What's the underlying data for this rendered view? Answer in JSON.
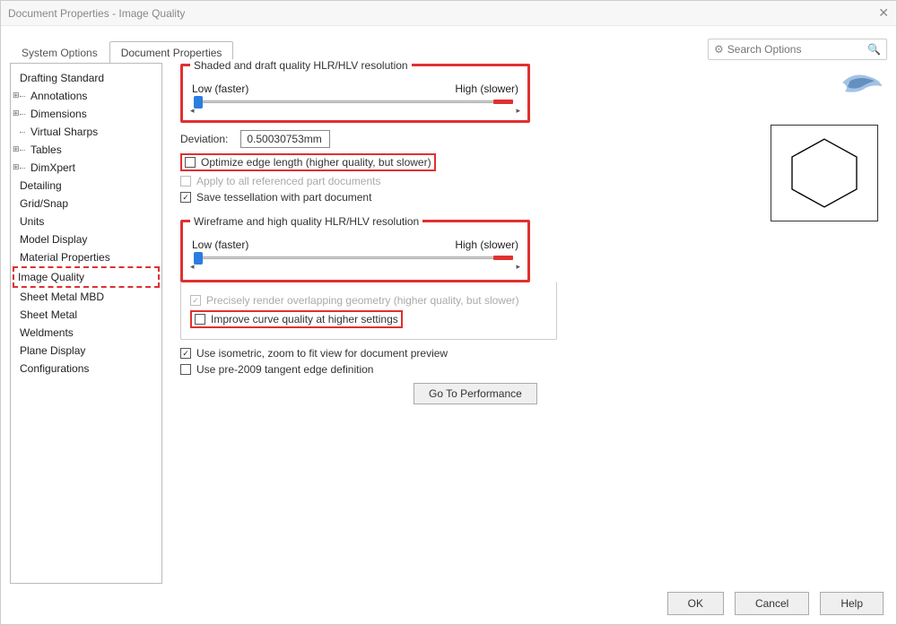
{
  "window": {
    "title": "Document Properties - Image Quality"
  },
  "tabs": {
    "system": "System Options",
    "document": "Document Properties"
  },
  "search": {
    "placeholder": "Search Options"
  },
  "tree": [
    {
      "label": "Drafting Standard",
      "level": 0
    },
    {
      "label": "Annotations",
      "level": 1,
      "exp": true
    },
    {
      "label": "Dimensions",
      "level": 1,
      "exp": true
    },
    {
      "label": "Virtual Sharps",
      "level": 1,
      "exp": false
    },
    {
      "label": "Tables",
      "level": 1,
      "exp": true
    },
    {
      "label": "DimXpert",
      "level": 1,
      "exp": true
    },
    {
      "label": "Detailing",
      "level": 0
    },
    {
      "label": "Grid/Snap",
      "level": 0
    },
    {
      "label": "Units",
      "level": 0
    },
    {
      "label": "Model Display",
      "level": 0
    },
    {
      "label": "Material Properties",
      "level": 0
    },
    {
      "label": "Image Quality",
      "level": 0,
      "highlight": true
    },
    {
      "label": "Sheet Metal MBD",
      "level": 0
    },
    {
      "label": "Sheet Metal",
      "level": 0
    },
    {
      "label": "Weldments",
      "level": 0
    },
    {
      "label": "Plane Display",
      "level": 0
    },
    {
      "label": "Configurations",
      "level": 0
    }
  ],
  "group1": {
    "title": "Shaded and draft quality HLR/HLV resolution",
    "low": "Low (faster)",
    "high": "High (slower)"
  },
  "deviation": {
    "label": "Deviation:",
    "value": "0.50030753mm"
  },
  "checks": {
    "optimize": "Optimize edge length (higher quality, but slower)",
    "applyall": "Apply to all referenced part documents",
    "savetess": "Save tessellation with part document"
  },
  "group2": {
    "title": "Wireframe and high quality HLR/HLV resolution",
    "low": "Low (faster)",
    "high": "High (slower)"
  },
  "checks2": {
    "precise": "Precisely render overlapping geometry (higher quality, but slower)",
    "improve": "Improve curve quality at higher settings"
  },
  "checks3": {
    "iso": "Use isometric, zoom to fit view for document preview",
    "pre2009": "Use pre-2009 tangent edge definition"
  },
  "goto": "Go To Performance",
  "buttons": {
    "ok": "OK",
    "cancel": "Cancel",
    "help": "Help"
  }
}
